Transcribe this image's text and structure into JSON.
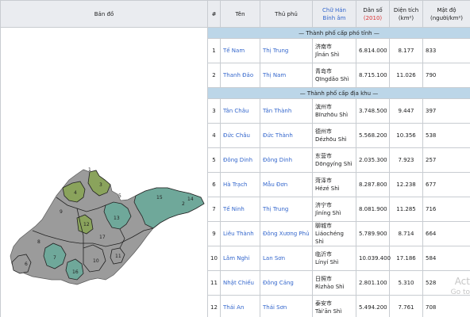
{
  "headers": {
    "map": "Bản đồ",
    "num": "#",
    "name": "Tên",
    "seat": "Thủ phủ",
    "han1": "Chữ Hán",
    "han2": "Bính âm",
    "pop1": "Dân số",
    "pop2": "(2010)",
    "area1": "Diện tích",
    "area2": "(km²)",
    "dens1": "Mật độ",
    "dens2": "(người/km²)"
  },
  "sections": {
    "sub_provincial": "— Thành phố cấp phó tỉnh —",
    "prefecture": "— Thành phố cấp địa khu —"
  },
  "rows_top": [
    {
      "no": "1",
      "name": "Tế Nam",
      "seat": "Thị Trung",
      "hanzi": "济南市",
      "pinyin": "Jǐnán Shì",
      "pop": "6.814.000",
      "area": "8.177",
      "density": "833"
    },
    {
      "no": "2",
      "name": "Thanh Đảo",
      "seat": "Thị Nam",
      "hanzi": "青岛市",
      "pinyin": "Qīngdǎo Shì",
      "pop": "8.715.100",
      "area": "11.026",
      "density": "790"
    }
  ],
  "rows_bottom": [
    {
      "no": "3",
      "name": "Tân Châu",
      "seat": "Tân Thành",
      "hanzi": "滨州市",
      "pinyin": "Bīnzhōu Shì",
      "pop": "3.748.500",
      "area": "9.447",
      "density": "397"
    },
    {
      "no": "4",
      "name": "Đức Châu",
      "seat": "Đức Thành",
      "hanzi": "德州市",
      "pinyin": "Dézhōu Shì",
      "pop": "5.568.200",
      "area": "10.356",
      "density": "538"
    },
    {
      "no": "5",
      "name": "Đông Dinh",
      "seat": "Đông Dinh",
      "hanzi": "东营市",
      "pinyin": "Dōngyíng Shì",
      "pop": "2.035.300",
      "area": "7.923",
      "density": "257"
    },
    {
      "no": "6",
      "name": "Hà Trạch",
      "seat": "Mẫu Đơn",
      "hanzi": "菏泽市",
      "pinyin": "Hézé Shì",
      "pop": "8.287.800",
      "area": "12.238",
      "density": "677"
    },
    {
      "no": "7",
      "name": "Tế Ninh",
      "seat": "Thị Trung",
      "hanzi": "济宁市",
      "pinyin": "Jìníng Shì",
      "pop": "8.081.900",
      "area": "11.285",
      "density": "716"
    },
    {
      "no": "9",
      "name": "Liêu Thành",
      "seat": "Đông Xương Phủ",
      "hanzi": "聊城市",
      "pinyin": "Liáochéng Shì",
      "pop": "5.789.900",
      "area": "8.714",
      "density": "664"
    },
    {
      "no": "10",
      "name": "Lâm Nghi",
      "seat": "Lan Sơn",
      "hanzi": "临沂市",
      "pinyin": "Línyí Shì",
      "pop": "10.039.400",
      "area": "17.186",
      "density": "584"
    },
    {
      "no": "11",
      "name": "Nhật Chiếu",
      "seat": "Đông Cảng",
      "hanzi": "日照市",
      "pinyin": "Rìzhào Shì",
      "pop": "2.801.100",
      "area": "5.310",
      "density": "528"
    },
    {
      "no": "12",
      "name": "Thái An",
      "seat": "Thái Sơn",
      "hanzi": "泰安市",
      "pinyin": "Tài'ān Shì",
      "pop": "5.494.200",
      "area": "7.761",
      "density": "708"
    }
  ],
  "map_labels": [
    "1",
    "2",
    "3",
    "4",
    "5",
    "6",
    "7",
    "8",
    "9",
    "10",
    "11",
    "12",
    "13",
    "14",
    "15",
    "16",
    "17"
  ],
  "watermark": {
    "line1": "Act",
    "line2": "Go to"
  },
  "colors": {
    "sea_green": "#6fa89a",
    "olive_green": "#8aa35c",
    "gray": "#9b9b9b",
    "link": "#3366cc",
    "section": "#bcd6e8"
  }
}
